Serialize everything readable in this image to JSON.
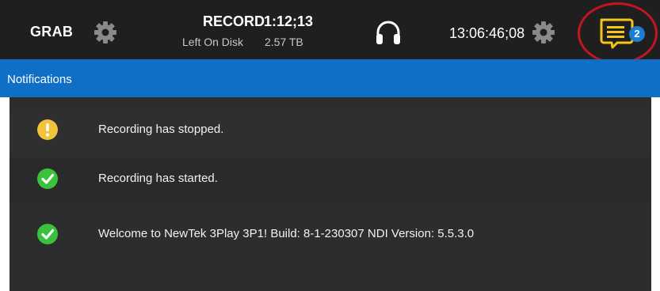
{
  "topbar": {
    "grab_label": "GRAB",
    "record_label": "RECORD",
    "record_time": "1:12;13",
    "disk_label": "Left On Disk",
    "disk_value": "2.57 TB",
    "timecode": "13:06:46;08",
    "notification_count": "2",
    "icons": {
      "grab_settings": "gear-icon",
      "audio": "headphones-icon",
      "time_settings": "gear-icon",
      "notifications": "message-icon"
    }
  },
  "notifications": {
    "title": "Notifications",
    "items": [
      {
        "type": "warning",
        "icon": "exclamation-circle-icon",
        "message": "Recording has stopped."
      },
      {
        "type": "success",
        "icon": "check-circle-icon",
        "message": "Recording has started."
      },
      {
        "type": "success",
        "icon": "check-circle-icon",
        "message": "Welcome to NewTek 3Play 3P1! Build: 8-1-230307 NDI Version: 5.5.3.0"
      }
    ]
  },
  "colors": {
    "topbar_bg": "#1f1f1f",
    "header_blue": "#0f6fc6",
    "panel_bg": "#2d2d2d",
    "warning_yellow": "#f2c23a",
    "success_green": "#3cc13c",
    "notification_icon_yellow": "#f5c518",
    "badge_blue": "#1a7fd4",
    "callout_red": "#c0161f"
  }
}
